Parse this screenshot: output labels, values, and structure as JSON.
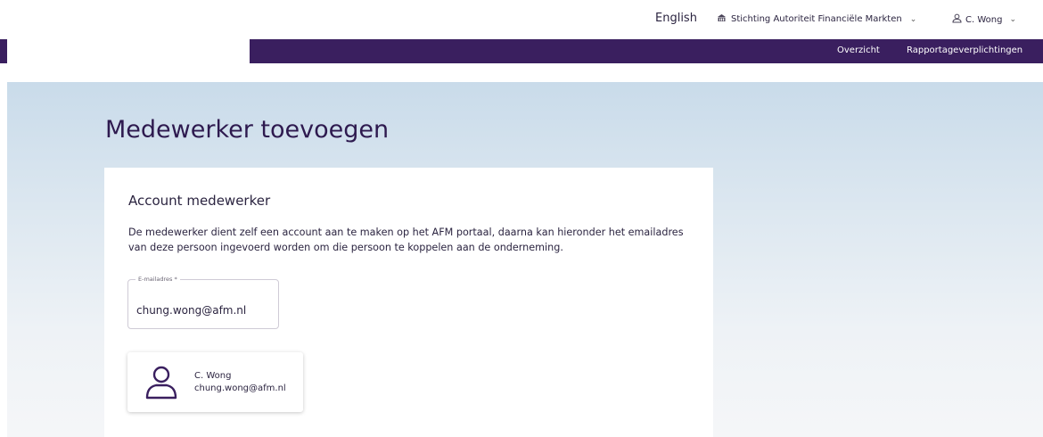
{
  "header": {
    "language": "English",
    "organization": "Stichting Autoriteit Financiële Markten",
    "user": "C. Wong"
  },
  "nav": {
    "items": [
      {
        "label": "Overzicht"
      },
      {
        "label": "Rapportageverplichtingen"
      }
    ]
  },
  "page": {
    "title": "Medewerker toevoegen"
  },
  "card": {
    "heading": "Account medewerker",
    "description": "De medewerker dient zelf een account aan te maken op het AFM portaal, daarna kan hieronder het emailadres van deze persoon ingevoerd worden om die persoon te koppelen aan de onderneming.",
    "email_field": {
      "label": "E-mailadres *",
      "value": "chung.wong@afm.nl"
    },
    "person": {
      "name": "C. Wong",
      "email": "chung.wong@afm.nl"
    }
  },
  "icons": {
    "organization": "building-icon",
    "user": "user-icon",
    "person": "person-icon"
  },
  "colors": {
    "brand": "#3a1f5f",
    "title": "#2e1a4f"
  }
}
